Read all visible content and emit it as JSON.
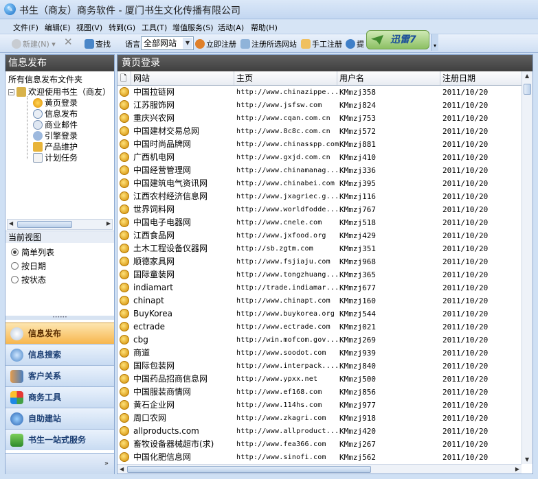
{
  "window": {
    "title": "书生（商友）商务软件 - 厦门书生文化传播有限公司",
    "icon": "app-logo-icon"
  },
  "menu": [
    "文件(F)",
    "编辑(E)",
    "视图(V)",
    "转到(G)",
    "工具(T)",
    "增值服务(S)",
    "活动(A)",
    "帮助(H)"
  ],
  "toolbar": {
    "new": "新建(N)",
    "find": "查找",
    "language_label": "语言",
    "language_value": "全部网站",
    "register_now": "立即注册",
    "register_selected": "注册所选网站",
    "manual_register": "手工注册",
    "submit_partial": "提",
    "xunlei_label": "迅雷7"
  },
  "left": {
    "header": "信息发布",
    "subhead": "所有信息发布文件夹",
    "tree_root": "欢迎使用书生（商友）",
    "tree_items": [
      {
        "label": "黄页登录",
        "icon": "globe-icon"
      },
      {
        "label": "信息发布",
        "icon": "clock-icon"
      },
      {
        "label": "商业邮件",
        "icon": "mail-icon"
      },
      {
        "label": "引擎登录",
        "icon": "search-engine-icon"
      },
      {
        "label": "产品维护",
        "icon": "box-icon"
      },
      {
        "label": "计划任务",
        "icon": "schedule-icon"
      }
    ],
    "view_header": "当前视图",
    "views": [
      {
        "label": "简单列表",
        "selected": true
      },
      {
        "label": "按日期",
        "selected": false
      },
      {
        "label": "按状态",
        "selected": false
      }
    ],
    "nav": [
      {
        "label": "信息发布",
        "active": true,
        "icon": "publish-icon"
      },
      {
        "label": "信息搜索",
        "active": false,
        "icon": "magnifier-icon"
      },
      {
        "label": "客户关系",
        "active": false,
        "icon": "people-icon"
      },
      {
        "label": "商务工具",
        "active": false,
        "icon": "tools-icon"
      },
      {
        "label": "自助建站",
        "active": false,
        "icon": "website-icon"
      },
      {
        "label": "书生一站式服务",
        "active": false,
        "icon": "service-icon"
      }
    ]
  },
  "right": {
    "header": "黄页登录",
    "columns": [
      "网站",
      "主页",
      "用户名",
      "注册日期"
    ],
    "rows": [
      [
        "中国拉链网",
        "http://www.chinazippe...",
        "KMmzj358",
        "2011/10/20"
      ],
      [
        "江苏服饰网",
        "http://www.jsfsw.com",
        "KMmzj824",
        "2011/10/20"
      ],
      [
        "重庆兴农网",
        "http://www.cqan.com.cn",
        "KMmzj753",
        "2011/10/20"
      ],
      [
        "中国建材交易总网",
        "http://www.8c8c.com.cn",
        "KMmzj572",
        "2011/10/20"
      ],
      [
        "中国时尚品牌网",
        "http://www.chinasspp.com",
        "KMmzj881",
        "2011/10/20"
      ],
      [
        "广西机电网",
        "http://www.gxjd.com.cn",
        "KMmzj410",
        "2011/10/20"
      ],
      [
        "中国经营管理网",
        "http://www.chinamanag...",
        "KMmzj336",
        "2011/10/20"
      ],
      [
        "中国建筑电气资讯网",
        "http://www.chinabei.com",
        "KMmzj395",
        "2011/10/20"
      ],
      [
        "江西农村经济信息网",
        "http://www.jxagriec.g...",
        "KMmzj116",
        "2011/10/20"
      ],
      [
        "世界饲料网",
        "http://www.worldfodde...",
        "KMmzj767",
        "2011/10/20"
      ],
      [
        "中国电子电器网",
        "http://www.cnele.com",
        "KMmzj518",
        "2011/10/20"
      ],
      [
        "江西食品网",
        "http://www.jxfood.org",
        "KMmzj429",
        "2011/10/20"
      ],
      [
        "土木工程设备仪器网",
        "http://sb.zgtm.com",
        "KMmzj351",
        "2011/10/20"
      ],
      [
        "顺德家具网",
        "http://www.fsjiaju.com",
        "KMmzj968",
        "2011/10/20"
      ],
      [
        "国际童装网",
        "http://www.tongzhuang...",
        "KMmzj365",
        "2011/10/20"
      ],
      [
        "indiamart",
        "http://trade.indiamar...",
        "KMmzj677",
        "2011/10/20"
      ],
      [
        "chinapt",
        "http://www.chinapt.com",
        "KMmzj160",
        "2011/10/20"
      ],
      [
        "BuyKorea",
        "http://www.buykorea.org",
        "KMmzj544",
        "2011/10/20"
      ],
      [
        "ectrade",
        "http://www.ectrade.com",
        "KMmzj021",
        "2011/10/20"
      ],
      [
        "cbg",
        "http://win.mofcom.gov...",
        "KMmzj269",
        "2011/10/20"
      ],
      [
        "商道",
        "http://www.soodot.com",
        "KMmzj939",
        "2011/10/20"
      ],
      [
        "国际包装网",
        "http://www.interpack....",
        "KMmzj840",
        "2011/10/20"
      ],
      [
        "中国药品招商信息网",
        "http://www.ypxx.net",
        "KMmzj500",
        "2011/10/20"
      ],
      [
        "中国服装商情网",
        "http://www.ef168.com",
        "KMmzj856",
        "2011/10/20"
      ],
      [
        "黄石企业网",
        "http://www.114hs.com",
        "KMmzj977",
        "2011/10/20"
      ],
      [
        "周口农网",
        "http://www.zkagri.com",
        "KMmzj918",
        "2011/10/20"
      ],
      [
        "allproducts.com",
        "http://www.allproduct...",
        "KMmzj420",
        "2011/10/20"
      ],
      [
        "畜牧设备器械超市(求)",
        "http://www.fea366.com",
        "KMmzj267",
        "2011/10/20"
      ],
      [
        "中国化肥信息网",
        "http://www.sinofi.com",
        "KMmzj562",
        "2011/10/20"
      ]
    ]
  }
}
